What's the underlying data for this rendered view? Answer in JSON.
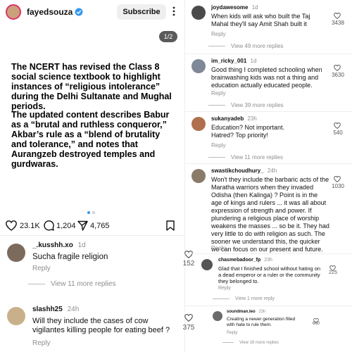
{
  "post": {
    "username": "fayedsouza",
    "subscribe_label": "Subscribe",
    "page_indicator": "1/2",
    "paragraph1": "The NCERT has revised the Class 8 social science textbook to highlight instances of “religious intolerance” during the Delhi Sultanate and Mughal periods.",
    "paragraph2": "The updated content describes Babur as a “brutal and ruthless conqueror,” Akbar’s rule as a “blend of brutality and tolerance,” and notes that Aurangzeb destroyed temples and gurdwaras.",
    "likes": "23.1K",
    "comments": "1,204",
    "shares": "4,765"
  },
  "left_comments": [
    {
      "user": "_.kusshh.xo",
      "time": "1d",
      "text": "Sucha fragile religion",
      "reply": "Reply",
      "more": "View 11 more replies",
      "likes": "152"
    },
    {
      "user": "slashh25",
      "time": "24h",
      "text": "Will they include the cases of cow vigilantes killing people for eating beef ?",
      "reply": "Reply",
      "likes": "375"
    }
  ],
  "right_comments": [
    {
      "user": "joydawesome",
      "time": "1d",
      "text": "When kids will ask who built the Taj Mahal they'll say Amit Shah built it",
      "reply": "Reply",
      "more": "View 49 more replies",
      "likes": "3438"
    },
    {
      "user": "im_ricky_001",
      "time": "1d",
      "text": "Good thing I completed schooling when brainwashing kids was not a thing and education actually educated people.",
      "reply": "Reply",
      "more": "View 39 more replies",
      "likes": "3630"
    },
    {
      "user": "sukanyadeb",
      "time": "23h",
      "text": "Education? Not important. Hatred? Top priority!",
      "reply": "Reply",
      "more": "View 11 more replies",
      "likes": "540"
    },
    {
      "user": "swastikchoudhury_",
      "time": "24h",
      "text": "Won't they include the barbaric acts of the Maratha warriors when they invaded Odisha (then Kalinga) ? Point is in the age of kings and rulers ... it was all about expression of strength and power. If plundering a religious place of worship weakens the masses ... so be it. They had very little to do with religion as such. The sooner we understand this, the quicker we can focus on our present and future.",
      "reply": "Reply",
      "likes": "1030"
    },
    {
      "user": "chasmebadoor_fp",
      "time": "23h",
      "text": "Glad that I finished school without hating on a dead emperor or a ruler or the community they belonged to.",
      "reply": "Reply",
      "more": "View 1 more reply",
      "likes": "225"
    },
    {
      "user": "soundman.leo",
      "time": "23h",
      "text": "Creating a newer generation filled with hate to rule them.",
      "reply": "Reply",
      "more": "View 16 more replies",
      "likes": "660"
    }
  ]
}
